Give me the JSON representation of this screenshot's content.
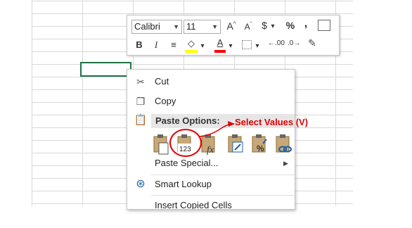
{
  "mini_toolbar": {
    "font_name": "Calibri",
    "font_size": "11",
    "buttons": [
      "A",
      "A",
      "$",
      "%",
      ",",
      "B",
      "I",
      "A",
      ".00",
      ".0"
    ]
  },
  "context_menu": {
    "cut": "Cut",
    "copy": "Copy",
    "paste_options": "Paste Options:",
    "paste_special": "Paste Special...",
    "smart_lookup": "Smart Lookup",
    "insert_copied_cells": "Insert Copied Cells",
    "values_badge": "123"
  },
  "annotation": {
    "text": "Select Values (V)",
    "color": "#e00000"
  },
  "colors": {
    "selection": "#217346",
    "highlight_yellow": "#ffff00",
    "font_red": "#ff0000",
    "paste_header_bg": "#e6e6e6"
  }
}
